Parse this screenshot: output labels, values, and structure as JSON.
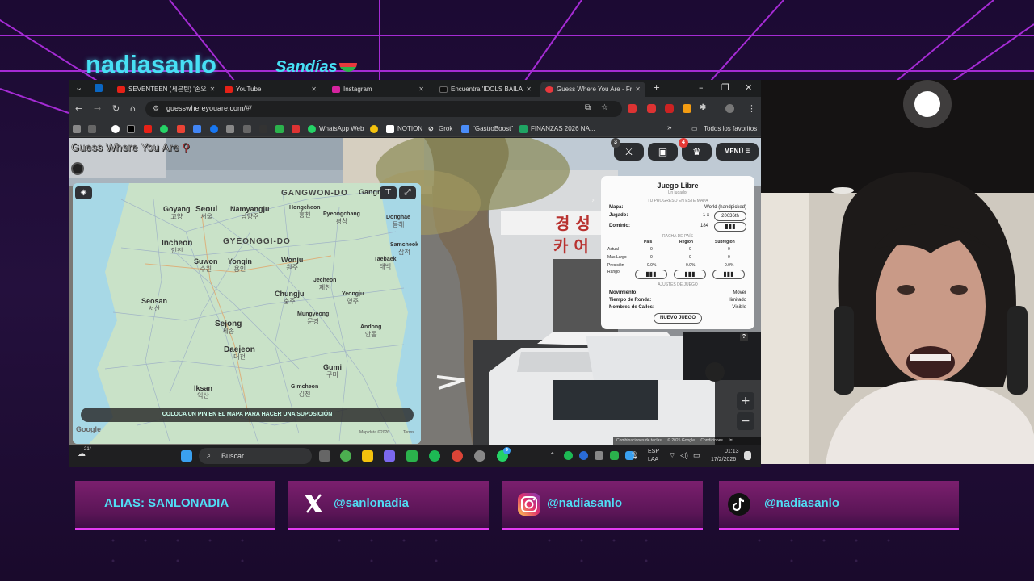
{
  "overlay": {
    "streamer_name": "nadiasanlo",
    "community_name": "Sandías",
    "accent_color": "#47e0f5",
    "socials": [
      {
        "platform": "alias",
        "label": "ALIAS: SANLONADIA"
      },
      {
        "platform": "x",
        "icon": "x-logo-icon",
        "label": "@sanlonadia"
      },
      {
        "platform": "instagram",
        "icon": "instagram-icon",
        "label": "@nadiasanlo"
      },
      {
        "platform": "tiktok",
        "icon": "tiktok-icon",
        "label": "@nadiasanlo_"
      }
    ]
  },
  "browser": {
    "tabs": [
      {
        "label": "SEVENTEEN (세븐틴) '손오",
        "icon": "youtube-icon",
        "color": "#e62117"
      },
      {
        "label": "YouTube",
        "icon": "youtube-icon",
        "color": "#e62117"
      },
      {
        "label": "Instagram",
        "icon": "instagram-icon",
        "color": "#d6249f"
      },
      {
        "label": "Encuentra 'IDOLS BAILAN",
        "icon": "tiktok-icon",
        "color": "#111111"
      },
      {
        "label": "Guess Where You Are - Fr",
        "icon": "pin-icon",
        "color": "#e8383d"
      }
    ],
    "url": "guesswhereyouare.com/#/",
    "bookmarks": [
      {
        "label": "WhatsApp Web",
        "color": "#25d366"
      },
      {
        "label": "NOTION",
        "color": "#ffffff"
      },
      {
        "label": "Grok",
        "color": "#dddddd"
      },
      {
        "label": "\"GastroBoost\"",
        "color": "#4a8cf7"
      },
      {
        "label": "FINANZAS 2026 NA...",
        "color": "#1fa463"
      }
    ],
    "bookmarks_more": "»",
    "all_bookmarks": "Todos los favoritos"
  },
  "game": {
    "logo": "Guess Where You Are",
    "toolbar": {
      "battle_badge": "3",
      "bus_badge": "4",
      "menu_label": "MENÚ"
    },
    "map": {
      "labels": {
        "gangwon": "GANGWON-DO",
        "gangneung": "Gangn",
        "goyang": "Goyang",
        "goyang_ko": "고양",
        "seoul": "Seoul",
        "seoul_ko": "서울",
        "namyangju": "Namyangju",
        "namyangju_ko": "남양주",
        "hongcheon": "Hongcheon",
        "hongcheon_ko": "홍천",
        "pyeongchang": "Pyeongchang",
        "pyeongchang_ko": "평창",
        "donghae": "Donghae",
        "donghae_ko": "동해",
        "incheon": "Incheon",
        "incheon_ko": "인천",
        "gyeonggi": "GYEONGGI-DO",
        "samcheok": "Samcheok",
        "samcheok_ko": "삼척",
        "suwon": "Suwon",
        "suwon_ko": "수원",
        "yongin": "Yongin",
        "yongin_ko": "용인",
        "wonju": "Wonju",
        "wonju_ko": "원주",
        "taebaek": "Taebaek",
        "taebaek_ko": "태백",
        "jecheon": "Jecheon",
        "jecheon_ko": "제천",
        "chungju": "Chungju",
        "chungju_ko": "충주",
        "yeongju": "Yeongju",
        "yeongju_ko": "영주",
        "seosan": "Seosan",
        "seosan_ko": "서산",
        "mungyeong": "Mungyeong",
        "mungyeong_ko": "문경",
        "sejong": "Sejong",
        "sejong_ko": "세종",
        "andong": "Andong",
        "andong_ko": "안동",
        "daejeon": "Daejeon",
        "daejeon_ko": "대전",
        "gumi": "Gumi",
        "gumi_ko": "구미",
        "ikasan": "Iksan",
        "ikasan_ko": "익산",
        "gimcheon": "Gimcheon",
        "gimcheon_ko": "김천"
      },
      "pin_hint": "COLOCA UN PIN EN EL MAPA PARA HACER UNA SUPOSICIÓN",
      "google": "Google",
      "map_data": "Map data ©2026",
      "terms": "Terms"
    },
    "panel": {
      "title": "Juego Libre",
      "subtitle": "Un jugador",
      "progress_header": "TU PROGRESO EN ESTE MAPA",
      "mapa_label": "Mapa:",
      "mapa_value": "World (handpicked)",
      "jugado_label": "Jugado:",
      "jugado_value": "1 x",
      "jugado_rank": "20636th",
      "dominio_label": "Dominio:",
      "dominio_value": "184",
      "streak_header": "RACHA DE PAÍS",
      "col_pais": "País",
      "col_region": "Región",
      "col_subregion": "Subregión",
      "row_actual": "Actual",
      "row_largo": "Más Largo",
      "row_precision": "Precisión",
      "row_rango": "Rango",
      "zero": "0",
      "pct": "0.0%",
      "settings_header": "AJUSTES DE JUEGO",
      "mov_label": "Movimiento:",
      "mov_value": "Mover",
      "time_label": "Tiempo de Ronda:",
      "time_value": "Ilimitado",
      "streets_label": "Nombres de Calles:",
      "streets_value": "Visible",
      "new_game": "NUEVO JUEGO"
    },
    "sign_text_1": "경 성",
    "sign_text_2": "카 어",
    "footer": {
      "shortcuts": "Combinaciones de teclas",
      "copyright": "© 2025 Google",
      "conditions": "Condiciones",
      "more": "Inf"
    },
    "help": "?"
  },
  "taskbar": {
    "weather": "21°",
    "search": "Buscar",
    "lang_1": "ESP",
    "lang_2": "LAA",
    "time": "01:13",
    "date": "17/2/2026",
    "notify_badge": "9"
  }
}
